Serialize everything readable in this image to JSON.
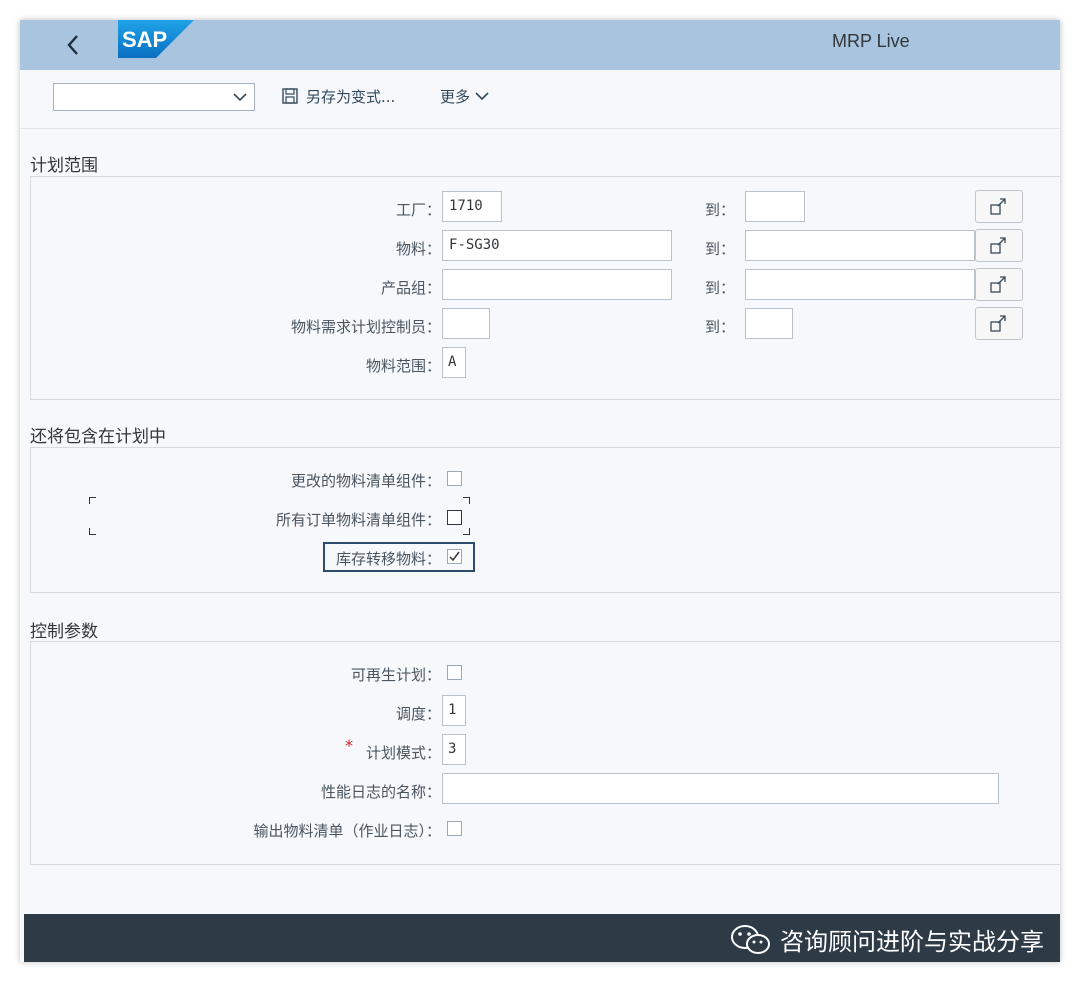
{
  "shell": {
    "app_title": "MRP Live",
    "logo_text": "SAP"
  },
  "toolbar": {
    "variant_value": "",
    "save_variant_label": "另存为变式...",
    "more_label": "更多"
  },
  "planning_scope": {
    "title": "计划范围",
    "to_label": "到：",
    "rows": [
      {
        "label": "工厂：",
        "from": "1710",
        "to": ""
      },
      {
        "label": "物料：",
        "from": "F-SG30",
        "to": ""
      },
      {
        "label": "产品组：",
        "from": "",
        "to": ""
      },
      {
        "label": "物料需求计划控制员：",
        "from": "",
        "to": ""
      }
    ],
    "material_scope": {
      "label": "物料范围：",
      "value": "A"
    }
  },
  "also_include": {
    "title": "还将包含在计划中",
    "items": [
      {
        "label": "更改的物料清单组件：",
        "checked": false
      },
      {
        "label": "所有订单物料清单组件：",
        "checked": false
      },
      {
        "label": "库存转移物料：",
        "checked": true
      }
    ]
  },
  "control_params": {
    "title": "控制参数",
    "regen_label": "可再生计划：",
    "regen_checked": false,
    "scheduling_label": "调度：",
    "scheduling_value": "1",
    "required_mark": "*",
    "planning_mode_label": "计划模式：",
    "planning_mode_value": "3",
    "perf_log_label": "性能日志的名称：",
    "perf_log_value": "",
    "output_bom_label": "输出物料清单（作业日志）：",
    "output_bom_checked": false
  },
  "footer": {
    "watermark": "咨询顾问进阶与实战分享"
  },
  "colors": {
    "shellbar": "#a8c4de",
    "footer": "#2e3a46",
    "focus": "#2e4d6e"
  }
}
